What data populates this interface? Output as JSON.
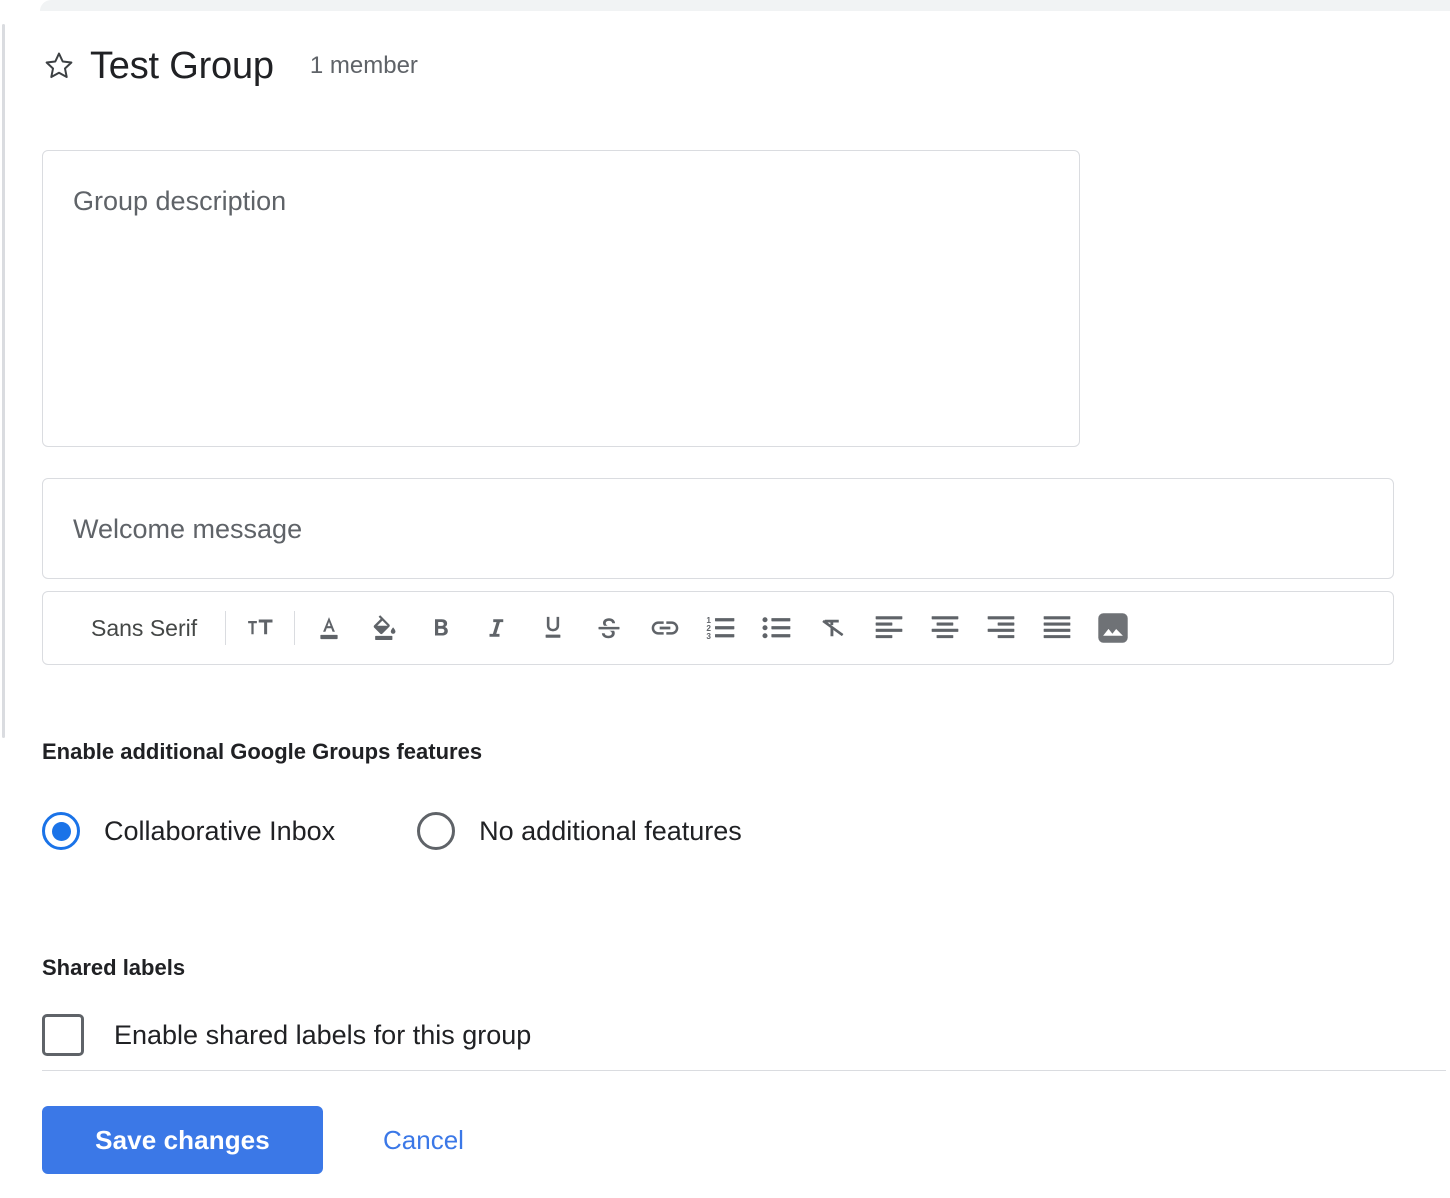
{
  "header": {
    "star_icon": "star-outline-icon",
    "title": "Test Group",
    "member_count": "1 member"
  },
  "form": {
    "description_placeholder": "Group description",
    "description_value": "",
    "welcome_placeholder": "Welcome message",
    "welcome_value": ""
  },
  "toolbar": {
    "font_name": "Sans Serif",
    "items": [
      {
        "name": "font-size-icon",
        "label": "Font size"
      },
      {
        "name": "text-color-icon",
        "label": "Text color"
      },
      {
        "name": "fill-color-icon",
        "label": "Highlight color"
      },
      {
        "name": "bold-icon",
        "label": "Bold"
      },
      {
        "name": "italic-icon",
        "label": "Italic"
      },
      {
        "name": "underline-icon",
        "label": "Underline"
      },
      {
        "name": "strikethrough-icon",
        "label": "Strikethrough"
      },
      {
        "name": "link-icon",
        "label": "Insert link"
      },
      {
        "name": "numbered-list-icon",
        "label": "Numbered list"
      },
      {
        "name": "bulleted-list-icon",
        "label": "Bulleted list"
      },
      {
        "name": "remove-formatting-icon",
        "label": "Remove formatting"
      },
      {
        "name": "align-left-icon",
        "label": "Align left"
      },
      {
        "name": "align-center-icon",
        "label": "Align center"
      },
      {
        "name": "align-right-icon",
        "label": "Align right"
      },
      {
        "name": "align-justify-icon",
        "label": "Justify"
      },
      {
        "name": "insert-image-icon",
        "label": "Insert image"
      }
    ]
  },
  "features": {
    "heading": "Enable additional Google Groups features",
    "options": [
      {
        "label": "Collaborative Inbox",
        "selected": true
      },
      {
        "label": "No additional features",
        "selected": false
      }
    ]
  },
  "shared_labels": {
    "heading": "Shared labels",
    "checkbox_label": "Enable shared labels for this group",
    "checked": false
  },
  "footer": {
    "save_label": "Save changes",
    "cancel_label": "Cancel"
  },
  "colors": {
    "accent": "#3b78e7",
    "radio_selected": "#1a73e8",
    "border": "#dadce0",
    "text_primary": "#202124",
    "text_secondary": "#5f6368",
    "top_strip": "#f1f3f4"
  }
}
